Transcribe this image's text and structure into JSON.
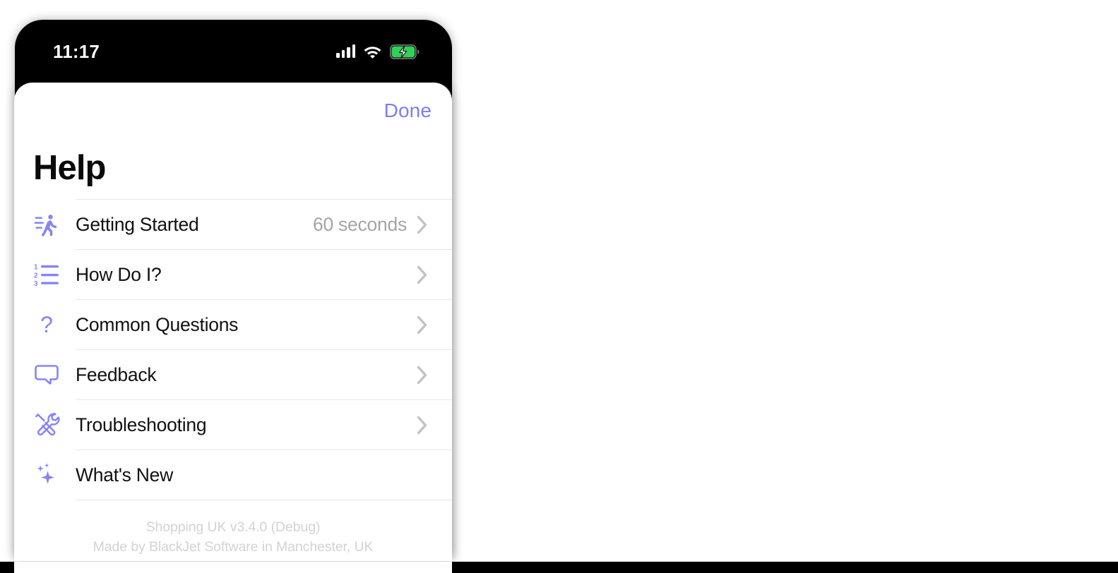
{
  "status_bar": {
    "time": "11:17",
    "cellular_icon": "cellular-bars-icon",
    "wifi_icon": "wifi-icon",
    "battery_icon": "battery-charging-icon",
    "battery_color": "#31d158"
  },
  "sheet": {
    "done_label": "Done",
    "title": "Help",
    "accent_color": "#7f7cf5",
    "background_card_color": "#d3decb"
  },
  "help_items": [
    {
      "label": "Getting Started",
      "detail": "60 seconds",
      "icon": "figure-walk-motion-icon",
      "has_chevron": true
    },
    {
      "label": "How Do I?",
      "detail": "",
      "icon": "list-number-icon",
      "has_chevron": true
    },
    {
      "label": "Common Questions",
      "detail": "",
      "icon": "question-mark-icon",
      "has_chevron": true
    },
    {
      "label": "Feedback",
      "detail": "",
      "icon": "speech-bubble-icon",
      "has_chevron": true
    },
    {
      "label": "Troubleshooting",
      "detail": "",
      "icon": "wrench-screwdriver-icon",
      "has_chevron": true
    },
    {
      "label": "What's New",
      "detail": "",
      "icon": "sparkles-icon",
      "has_chevron": false
    }
  ],
  "footer": {
    "line1": "Shopping UK v3.4.0 (Debug)",
    "line2": "Made by BlackJet Software in Manchester, UK"
  }
}
